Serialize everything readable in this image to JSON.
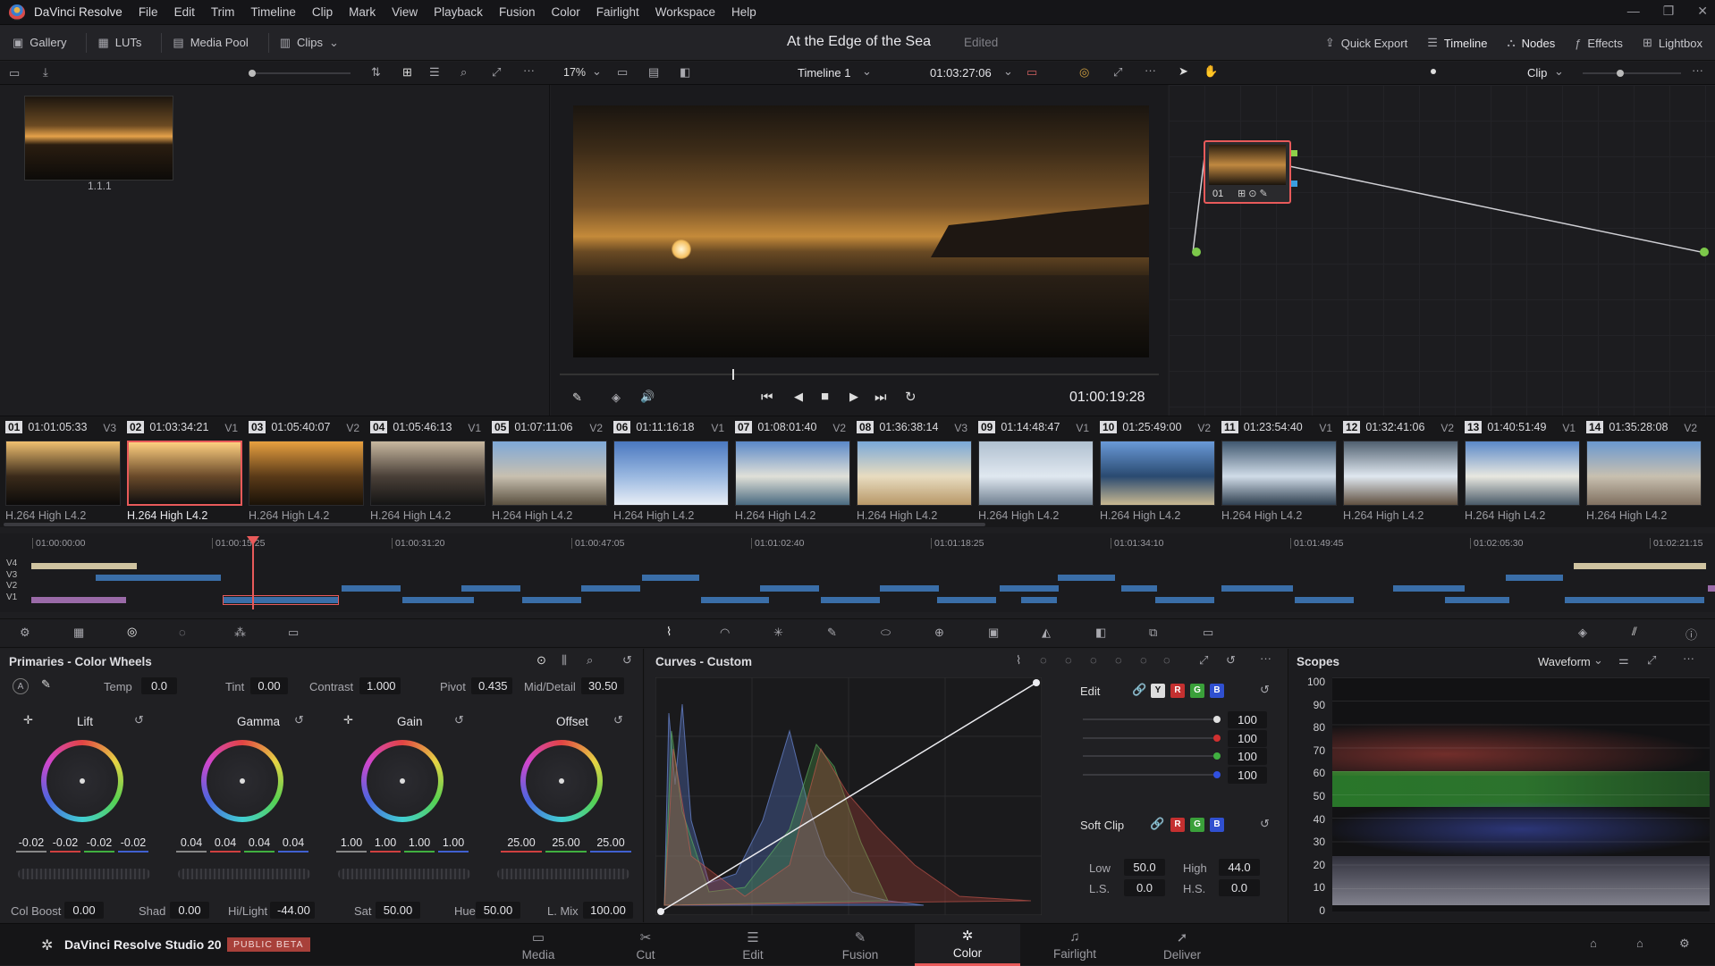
{
  "menubar": {
    "app": "DaVinci Resolve",
    "items": [
      "File",
      "Edit",
      "Trim",
      "Timeline",
      "Clip",
      "Mark",
      "View",
      "Playback",
      "Fusion",
      "Color",
      "Fairlight",
      "Workspace",
      "Help"
    ]
  },
  "toolbar": {
    "gallery": "Gallery",
    "luts": "LUTs",
    "media_pool": "Media Pool",
    "clips": "Clips",
    "project_title": "At the Edge of the Sea",
    "edited": "Edited",
    "quick_export": "Quick Export",
    "timeline": "Timeline",
    "nodes": "Nodes",
    "effects": "Effects",
    "lightbox": "Lightbox"
  },
  "subbar": {
    "zoom": "17%",
    "timeline_name": "Timeline 1",
    "timecode": "01:03:27:06",
    "clip_mode": "Clip"
  },
  "gallery": {
    "still_label": "1.1.1"
  },
  "viewer": {
    "playhead_tc": "01:00:19:28"
  },
  "node": {
    "label": "01"
  },
  "clips": [
    {
      "num": "01",
      "tc": "01:01:05:33",
      "track": "V3",
      "codec": "H.264 High L4.2",
      "colors": [
        "#f0c070",
        "#3a2a1a",
        "#0c0b0a"
      ]
    },
    {
      "num": "02",
      "tc": "01:03:34:21",
      "track": "V1",
      "codec": "H.264 High L4.2",
      "colors": [
        "#ffd080",
        "#6a4a2a",
        "#121010"
      ]
    },
    {
      "num": "03",
      "tc": "01:05:40:07",
      "track": "V2",
      "codec": "H.264 High L4.2",
      "colors": [
        "#e8a040",
        "#5a3a18",
        "#1a1208"
      ]
    },
    {
      "num": "04",
      "tc": "01:05:46:13",
      "track": "V1",
      "codec": "H.264 High L4.2",
      "colors": [
        "#c8b8a0",
        "#4a4038",
        "#141414"
      ]
    },
    {
      "num": "05",
      "tc": "01:07:11:06",
      "track": "V2",
      "codec": "H.264 High L4.2",
      "colors": [
        "#7ea8d8",
        "#c8c0b0",
        "#5a5040"
      ]
    },
    {
      "num": "06",
      "tc": "01:11:16:18",
      "track": "V1",
      "codec": "H.264 High L4.2",
      "colors": [
        "#4a78c0",
        "#9ab8e0",
        "#e8eef6"
      ]
    },
    {
      "num": "07",
      "tc": "01:08:01:40",
      "track": "V2",
      "codec": "H.264 High L4.2",
      "colors": [
        "#5a88c8",
        "#e0e0d8",
        "#4a6a80"
      ]
    },
    {
      "num": "08",
      "tc": "01:36:38:14",
      "track": "V3",
      "codec": "H.264 High L4.2",
      "colors": [
        "#7aa8d8",
        "#e8dcc0",
        "#b89868"
      ]
    },
    {
      "num": "09",
      "tc": "01:14:48:47",
      "track": "V1",
      "codec": "H.264 High L4.2",
      "colors": [
        "#b0c0d0",
        "#e0e8f0",
        "#708090"
      ]
    },
    {
      "num": "10",
      "tc": "01:25:49:00",
      "track": "V2",
      "codec": "H.264 High L4.2",
      "colors": [
        "#6a9ad8",
        "#2a4a70",
        "#c8b890"
      ]
    },
    {
      "num": "11",
      "tc": "01:23:54:40",
      "track": "V1",
      "codec": "H.264 High L4.2",
      "colors": [
        "#405870",
        "#d0dce8",
        "#304050"
      ]
    },
    {
      "num": "12",
      "tc": "01:32:41:06",
      "track": "V2",
      "codec": "H.264 High L4.2",
      "colors": [
        "#506070",
        "#e0e8f0",
        "#605040"
      ]
    },
    {
      "num": "13",
      "tc": "01:40:51:49",
      "track": "V1",
      "codec": "H.264 High L4.2",
      "colors": [
        "#5a88c8",
        "#e8e8e0",
        "#4a5a68"
      ]
    },
    {
      "num": "14",
      "tc": "01:35:28:08",
      "track": "V2",
      "codec": "H.264 High L4.2",
      "colors": [
        "#6a98d0",
        "#c8c0b0",
        "#807060"
      ]
    }
  ],
  "minitimeline": {
    "ticks": [
      "01:00:00:00",
      "01:00:15:25",
      "01:00:31:20",
      "01:00:47:05",
      "01:01:02:40",
      "01:01:18:25",
      "01:01:34:10",
      "01:01:49:45",
      "01:02:05:30",
      "01:02:21:15"
    ],
    "tracks": [
      "V4",
      "V3",
      "V2",
      "V1"
    ]
  },
  "primaries": {
    "title": "Primaries - Color Wheels",
    "temp_label": "Temp",
    "temp": "0.0",
    "tint_label": "Tint",
    "tint": "0.00",
    "contrast_label": "Contrast",
    "contrast": "1.000",
    "pivot_label": "Pivot",
    "pivot": "0.435",
    "middetail_label": "Mid/Detail",
    "middetail": "30.50",
    "wheels": [
      {
        "name": "Lift",
        "vals": [
          "-0.02",
          "-0.02",
          "-0.02",
          "-0.02"
        ]
      },
      {
        "name": "Gamma",
        "vals": [
          "0.04",
          "0.04",
          "0.04",
          "0.04"
        ]
      },
      {
        "name": "Gain",
        "vals": [
          "1.00",
          "1.00",
          "1.00",
          "1.00"
        ]
      },
      {
        "name": "Offset",
        "vals": [
          "25.00",
          "25.00",
          "25.00"
        ]
      }
    ],
    "colboost_label": "Col Boost",
    "colboost": "0.00",
    "shad_label": "Shad",
    "shad": "0.00",
    "hilight_label": "Hi/Light",
    "hilight": "-44.00",
    "sat_label": "Sat",
    "sat": "50.00",
    "hue_label": "Hue",
    "hue": "50.00",
    "lmix_label": "L. Mix",
    "lmix": "100.00"
  },
  "curves": {
    "title": "Curves - Custom",
    "edit_label": "Edit",
    "intensity": [
      "100",
      "100",
      "100",
      "100"
    ],
    "softclip_label": "Soft Clip",
    "low_label": "Low",
    "low": "50.0",
    "high_label": "High",
    "high": "44.0",
    "ls_label": "L.S.",
    "ls": "0.0",
    "hs_label": "H.S.",
    "hs": "0.0",
    "channels": [
      "Y",
      "R",
      "G",
      "B"
    ]
  },
  "scopes": {
    "title": "Scopes",
    "mode": "Waveform",
    "ticks": [
      "100",
      "90",
      "80",
      "70",
      "60",
      "50",
      "40",
      "30",
      "20",
      "10",
      "0"
    ]
  },
  "pagebar": {
    "brand": "DaVinci Resolve Studio 20",
    "badge": "PUBLIC BETA",
    "pages": [
      "Media",
      "Cut",
      "Edit",
      "Fusion",
      "Color",
      "Fairlight",
      "Deliver"
    ],
    "active": "Color"
  }
}
